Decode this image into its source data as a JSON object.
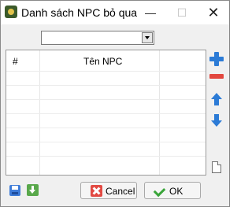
{
  "window": {
    "title": "Danh sách NPC bỏ qua",
    "minimize": "—",
    "maximize": "☐",
    "close": "✕"
  },
  "filter": {
    "value": ""
  },
  "grid": {
    "columns": [
      "#",
      "Tên NPC"
    ],
    "rows": []
  },
  "side_tools": [
    "plus-icon",
    "minus-icon",
    "arrow-up-icon",
    "arrow-down-icon",
    "document-icon"
  ],
  "footer": {
    "cancel_label": "Cancel",
    "ok_label": "OK"
  },
  "colors": {
    "accent_blue": "#2c7bd6",
    "remove_red": "#e2473f",
    "ok_green": "#3aa53a"
  }
}
